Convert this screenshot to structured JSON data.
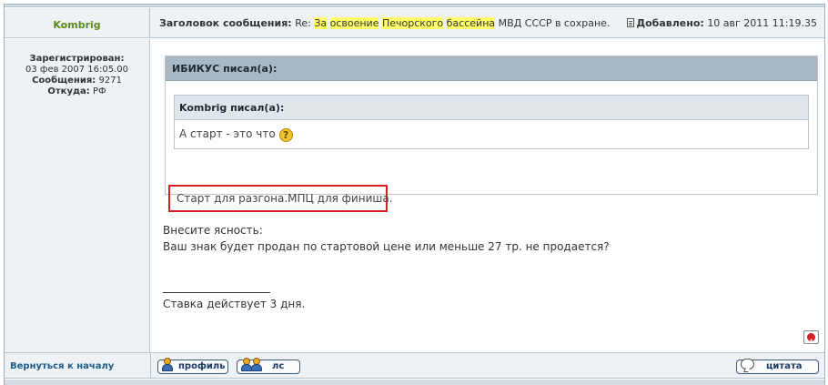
{
  "header": {
    "author": "Kombrig",
    "subject_label": "Заголовок сообщения:",
    "subject_prefix": "Re:",
    "subject_hl1": "За",
    "subject_hl2": "освоение",
    "subject_hl3": "Печорского",
    "subject_hl4": "бассейна",
    "subject_rest": "МВД СССР в сохране.",
    "added_label": "Добавлено:",
    "added_date": "10 авг 2011 11:19.35"
  },
  "profile": {
    "registered_label": "Зарегистрирован:",
    "registered_date": "03 фев 2007 16:05.00",
    "posts_label": "Сообщения:",
    "posts_count": "9271",
    "from_label": "Откуда:",
    "from_value": "РФ"
  },
  "post": {
    "outer_quote_header": "ИБИКУС писал(а):",
    "inner_quote_header": "Kombrig писал(а):",
    "inner_quote_text": "А старт - это что",
    "outer_quote_reply": "Старт для разгона.МПЦ для финиша.",
    "line1": "Внесите ясность:",
    "line2": "Ваш знак будет продан по стартовой цене или меньше 27 тр. не продается?",
    "signature": "Ставка действует 3 дня."
  },
  "footer": {
    "back_to_top": "Вернуться к началу",
    "profile_button": "профиль",
    "pm_button": "лс",
    "quote_button": "цитата"
  },
  "icons": {
    "question": "question-icon",
    "report": "report-icon",
    "document": "document-icon"
  },
  "colors": {
    "author_green": "#5a8a1a",
    "highlight_yellow": "#ffff66",
    "box_red": "#d81f26",
    "link_blue": "#1b5a8a"
  }
}
